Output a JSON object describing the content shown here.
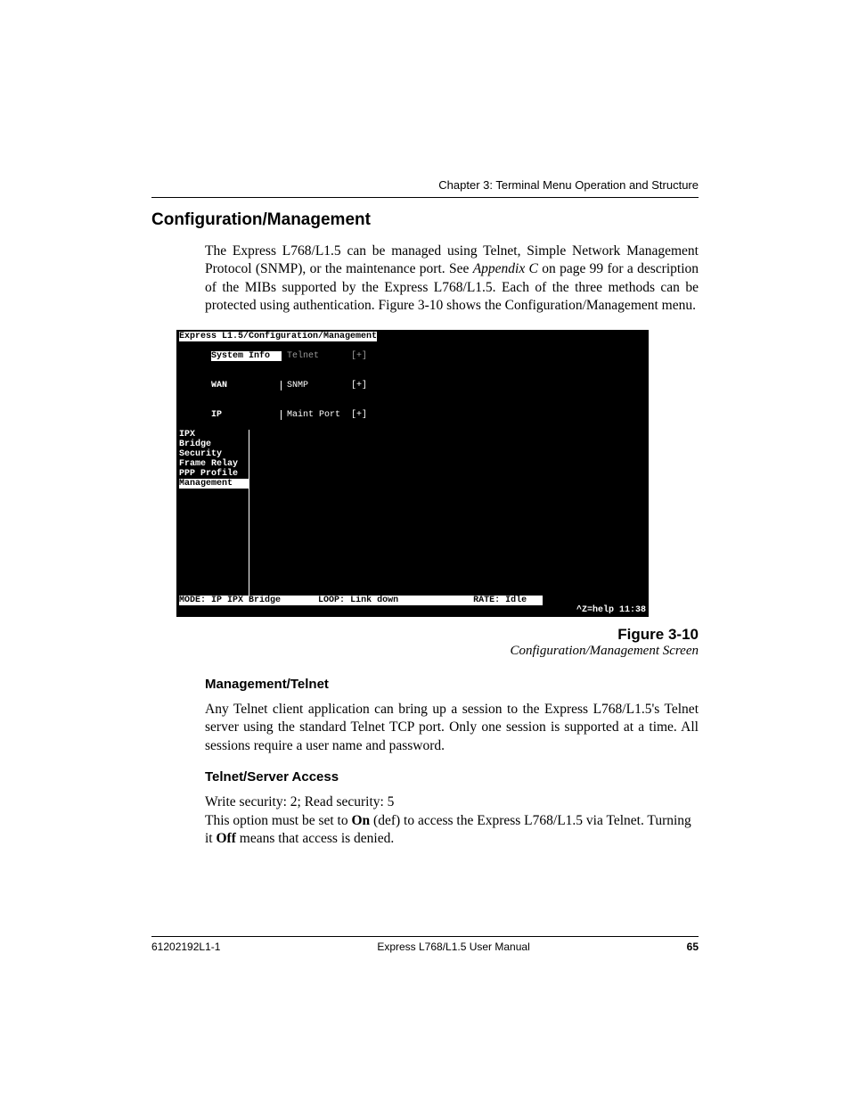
{
  "header": {
    "chapter": "Chapter 3: Terminal Menu Operation and Structure"
  },
  "section": {
    "title": "Configuration/Management"
  },
  "intro": {
    "para1_a": "The Express L768/L1.5 can be managed using Telnet, Simple Network Management Protocol (SNMP), or the maintenance port. See ",
    "appendix_ref": "Appendix C",
    "para1_b": " on page 99 for a description of the MIBs supported by the Express L768/L1.5. Each of the three methods can be protected using authentication. Figure 3-10 shows the Configuration/Management menu."
  },
  "terminal": {
    "title": "Express L1.5/Configuration/Management",
    "left_items": [
      "System Info",
      "WAN",
      "IP",
      "IPX",
      "Bridge",
      "Security",
      "Frame Relay",
      "PPP Profile",
      "Management"
    ],
    "right_items": [
      {
        "label": "Telnet",
        "suffix": "[+]"
      },
      {
        "label": "SNMP",
        "suffix": "[+]"
      },
      {
        "label": "Maint Port",
        "suffix": "[+]"
      }
    ],
    "status_mode_label": "MODE: ",
    "status_mode_value": "IP IPX Bridge",
    "status_loop_label": "LOOP: ",
    "status_loop_value": "Link down",
    "status_rate_label": "RATE: ",
    "status_rate_value": "Idle",
    "help": "^Z=help 11:38"
  },
  "figure": {
    "number": "Figure 3-10",
    "title": "Configuration/Management Screen"
  },
  "subsection1": {
    "heading": "Management/Telnet",
    "para": "Any Telnet client application can bring up a session to the Express L768/L1.5's Telnet server using the standard Telnet TCP port.  Only one session is supported at a time.  All sessions require a user name and password."
  },
  "subsection2": {
    "heading": "Telnet/Server Access",
    "security_line": "Write security: 2; Read security: 5",
    "p_a": "This option must be set to ",
    "on": "On",
    "p_b": " (def) to access the Express L768/L1.5 via Telnet. Turning it ",
    "off": "Off",
    "p_c": " means that access is denied."
  },
  "footer": {
    "left": "61202192L1-1",
    "center": "Express L768/L1.5 User Manual",
    "page": "65"
  }
}
